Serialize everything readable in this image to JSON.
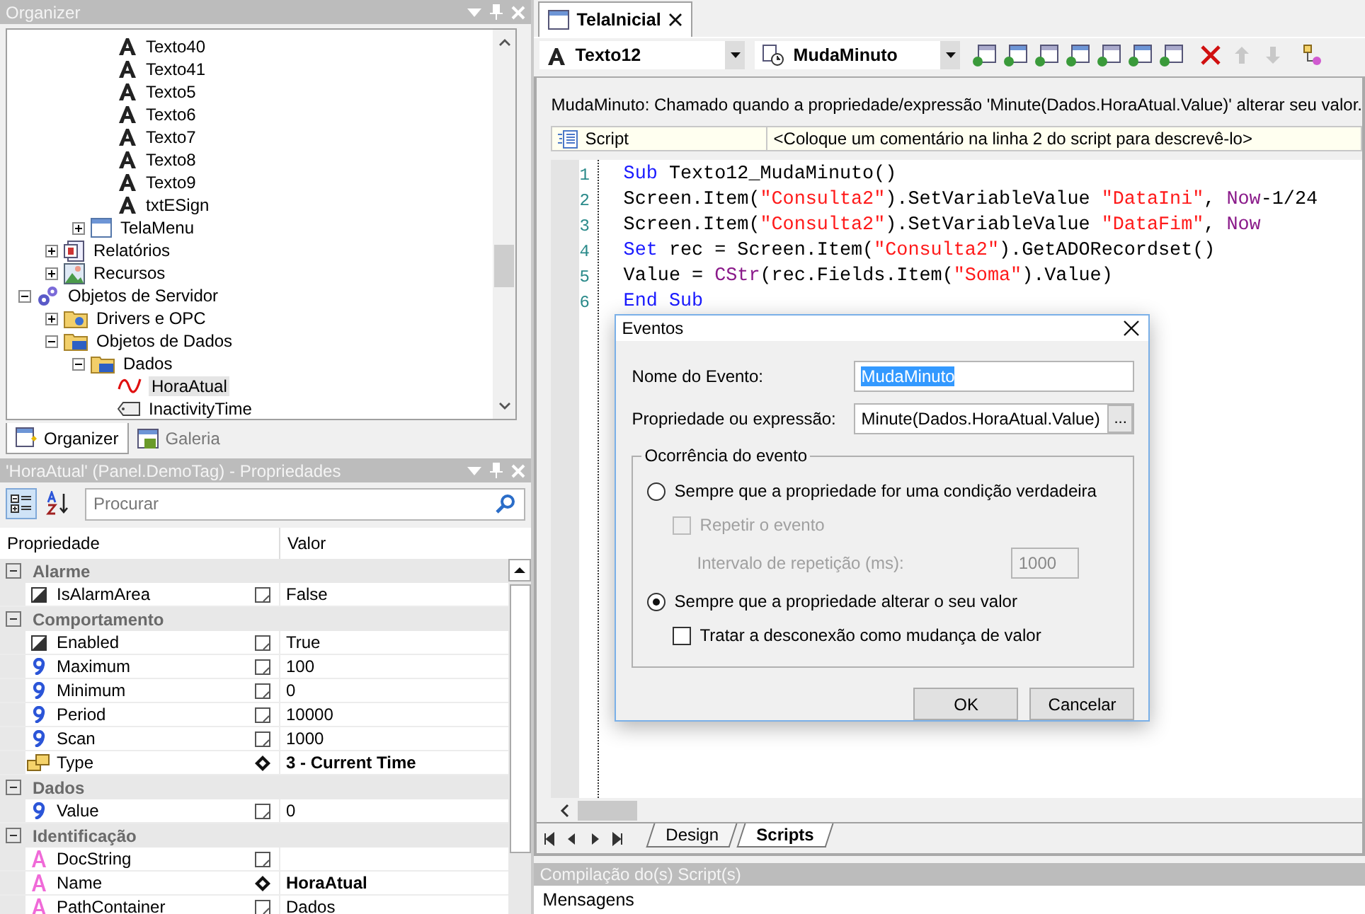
{
  "organizer": {
    "title": "Organizer",
    "tree": [
      {
        "children": [
          {
            "children": [
              {
                "children": [
                  {
                    "label": "Texto40",
                    "kind": "text",
                    "selected": false
                  },
                  {
                    "label": "Texto41",
                    "kind": "text",
                    "selected": false
                  },
                  {
                    "label": "Texto5",
                    "kind": "text",
                    "selected": false
                  },
                  {
                    "label": "Texto6",
                    "kind": "text",
                    "selected": false
                  },
                  {
                    "label": "Texto7",
                    "kind": "text",
                    "selected": false
                  },
                  {
                    "label": "Texto8",
                    "kind": "text",
                    "selected": false
                  },
                  {
                    "label": "Texto9",
                    "kind": "text",
                    "selected": false
                  },
                  {
                    "label": "txtESign",
                    "kind": "text",
                    "selected": false
                  }
                ]
              },
              {
                "label": "TelaMenu",
                "kind": "screen",
                "expanded": false,
                "selected": false
              }
            ]
          },
          {
            "label": "Relatórios",
            "kind": "reports",
            "expanded": false,
            "selected": false
          },
          {
            "label": "Recursos",
            "kind": "resources",
            "expanded": false,
            "selected": false
          }
        ]
      },
      {
        "label": "Objetos de Servidor",
        "kind": "server",
        "expanded": true,
        "selected": false,
        "children": [
          {
            "label": "Drivers e OPC",
            "kind": "folder",
            "expanded": false,
            "selected": false
          },
          {
            "label": "Objetos de Dados",
            "kind": "data-folder",
            "expanded": true,
            "selected": false,
            "children": [
              {
                "label": "Dados",
                "kind": "data-folder",
                "expanded": true,
                "selected": false,
                "children": [
                  {
                    "label": "HoraAtual",
                    "kind": "demo-tag",
                    "selected": true
                  },
                  {
                    "label": "InactivityTime",
                    "kind": "internal-tag",
                    "selected": false
                  }
                ]
              }
            ]
          }
        ]
      }
    ],
    "tabs": [
      {
        "label": "Organizer",
        "selected": true
      },
      {
        "label": "Galeria",
        "selected": false
      }
    ]
  },
  "properties": {
    "title": "'HoraAtual' (Panel.DemoTag) - Propriedades",
    "search": {
      "placeholder": "Procurar"
    },
    "columns": [
      "Propriedade",
      "Valor"
    ],
    "groups": [
      {
        "label": "Alarme",
        "expanded": true,
        "rows": [
          {
            "kind": "boolean",
            "name": "IsAlarmArea",
            "value": "False",
            "modified": false
          }
        ]
      },
      {
        "label": "Comportamento",
        "expanded": true,
        "rows": [
          {
            "kind": "boolean",
            "name": "Enabled",
            "value": "True",
            "modified": false
          },
          {
            "kind": "number",
            "name": "Maximum",
            "value": "100",
            "modified": false
          },
          {
            "kind": "number",
            "name": "Minimum",
            "value": "0",
            "modified": false
          },
          {
            "kind": "number",
            "name": "Period",
            "value": "10000",
            "modified": false
          },
          {
            "kind": "number",
            "name": "Scan",
            "value": "1000",
            "modified": false
          },
          {
            "kind": "enum",
            "name": "Type",
            "value": "3 - Current Time",
            "modified": true
          }
        ]
      },
      {
        "label": "Dados",
        "expanded": true,
        "rows": [
          {
            "kind": "number",
            "name": "Value",
            "value": "0",
            "modified": false
          }
        ]
      },
      {
        "label": "Identificação",
        "expanded": true,
        "rows": [
          {
            "kind": "text",
            "name": "DocString",
            "modified": false
          },
          {
            "kind": "text",
            "name": "Name",
            "value": "HoraAtual",
            "modified": true
          },
          {
            "kind": "text",
            "name": "PathContainer",
            "value": "Dados",
            "modified": false
          }
        ]
      }
    ]
  },
  "editor": {
    "tab": {
      "label": "TelaInicial"
    },
    "object_combo": "Texto12",
    "event_combo": "MudaMinuto",
    "description": "MudaMinuto: Chamado quando a propriedade/expressão 'Minute(Dados.HoraAtual.Value)' alterar seu valor.",
    "script_bar": {
      "label": "Script",
      "comment": "<Coloque um comentário na linha 2 do script para descrevê-lo>"
    },
    "code": [
      {
        "number": "1",
        "tokens": [
          {
            "kind": "keyword",
            "text": "Sub"
          },
          {
            "kind": "plain",
            "text": " Texto12_MudaMinuto()"
          }
        ]
      },
      {
        "number": "2",
        "tokens": [
          {
            "kind": "plain",
            "text": "Screen.Item("
          },
          {
            "kind": "string",
            "text": "\"Consulta2\""
          },
          {
            "kind": "plain",
            "text": ").SetVariableValue "
          },
          {
            "kind": "string",
            "text": "\"DataIni\""
          },
          {
            "kind": "plain",
            "text": ", "
          },
          {
            "kind": "function",
            "text": "Now"
          },
          {
            "kind": "plain",
            "text": "-1/24"
          }
        ]
      },
      {
        "number": "3",
        "tokens": [
          {
            "kind": "plain",
            "text": "Screen.Item("
          },
          {
            "kind": "string",
            "text": "\"Consulta2\""
          },
          {
            "kind": "plain",
            "text": ").SetVariableValue "
          },
          {
            "kind": "string",
            "text": "\"DataFim\""
          },
          {
            "kind": "plain",
            "text": ", "
          },
          {
            "kind": "function",
            "text": "Now"
          }
        ]
      },
      {
        "number": "4",
        "tokens": [
          {
            "kind": "keyword",
            "text": "Set"
          },
          {
            "kind": "plain",
            "text": " rec = Screen.Item("
          },
          {
            "kind": "string",
            "text": "\"Consulta2\""
          },
          {
            "kind": "plain",
            "text": ").GetADORecordset()"
          }
        ]
      },
      {
        "number": "5",
        "tokens": [
          {
            "kind": "plain",
            "text": "Value = "
          },
          {
            "kind": "function",
            "text": "CStr"
          },
          {
            "kind": "plain",
            "text": "(rec.Fields.Item("
          },
          {
            "kind": "string",
            "text": "\"Soma\""
          },
          {
            "kind": "plain",
            "text": ").Value)"
          }
        ]
      },
      {
        "number": "6",
        "tokens": [
          {
            "kind": "keyword",
            "text": "End Sub"
          }
        ]
      }
    ],
    "bottom_tabs": [
      {
        "label": "Design",
        "selected": false
      },
      {
        "label": "Scripts",
        "selected": true
      }
    ]
  },
  "dialog": {
    "title": "Eventos",
    "event_name": {
      "label": "Nome do Evento:",
      "value": "MudaMinuto",
      "text_selected": true
    },
    "expression": {
      "label": "Propriedade ou expressão:",
      "value": "Minute(Dados.HoraAtual.Value)",
      "button": "..."
    },
    "group": {
      "title": "Ocorrência do evento",
      "option_true": {
        "label": "Sempre que a propriedade for uma condição verdadeira",
        "selected": false
      },
      "repeat": {
        "label": "Repetir o evento",
        "checked": false,
        "disabled": true
      },
      "interval": {
        "label": "Intervalo de repetição (ms):",
        "value": "1000",
        "disabled": true
      },
      "option_change": {
        "label": "Sempre que a propriedade alterar o seu valor",
        "selected": true
      },
      "disconnect": {
        "label": "Tratar a desconexão como mudança de valor",
        "checked": false,
        "disabled": false
      }
    },
    "buttons": [
      "OK",
      "Cancelar"
    ]
  },
  "compile_panel": {
    "title": "Compilação do(s) Script(s)",
    "tab": "Mensagens"
  }
}
